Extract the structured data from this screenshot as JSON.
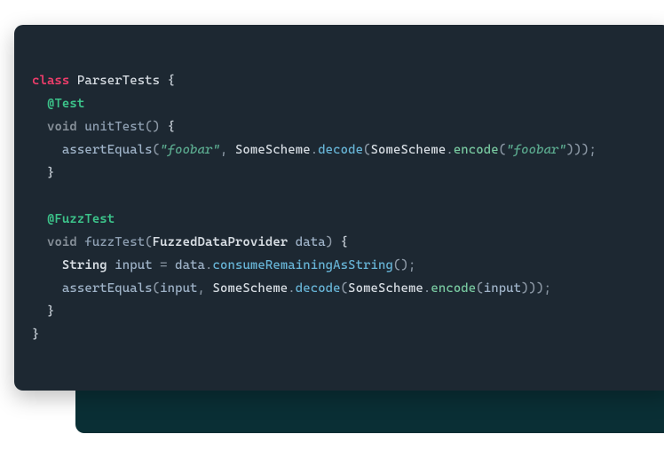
{
  "code": {
    "keyword_class": "class",
    "class_name": "ParserTests",
    "brace_open": "{",
    "annotation_test": "@Test",
    "keyword_void1": "void",
    "method_unit": "unitTest",
    "parens_empty": "()",
    "brace_open2": "{",
    "assert_equals1": "assertEquals",
    "paren_open1": "(",
    "string_foobar1": "\"foobar\"",
    "comma1": ",",
    "some_scheme1": "SomeScheme",
    "dot1": ".",
    "decode1": "decode",
    "paren_open2": "(",
    "some_scheme2": "SomeScheme",
    "dot2": ".",
    "encode1": "encode",
    "paren_open3": "(",
    "string_foobar2": "\"foobar\"",
    "close1": ")));",
    "brace_close1": "}",
    "annotation_fuzz": "@FuzzTest",
    "keyword_void2": "void",
    "method_fuzz": "fuzzTest",
    "paren_open4": "(",
    "type_provider": "FuzzedDataProvider",
    "param_data": "data",
    "paren_close_brace": ")",
    "brace_open3": "{",
    "type_string": "String",
    "var_input": "input",
    "eq": "=",
    "data_ref": "data",
    "dot3": ".",
    "consume": "consumeRemainingAsString",
    "parens_call": "();",
    "assert_equals2": "assertEquals",
    "paren_open5": "(",
    "input_ref1": "input",
    "comma2": ",",
    "some_scheme3": "SomeScheme",
    "dot4": ".",
    "decode2": "decode",
    "paren_open6": "(",
    "some_scheme4": "SomeScheme",
    "dot5": ".",
    "encode2": "encode",
    "paren_open7": "(",
    "input_ref2": "input",
    "close2": ")));",
    "brace_close2": "}",
    "brace_close3": "}"
  }
}
